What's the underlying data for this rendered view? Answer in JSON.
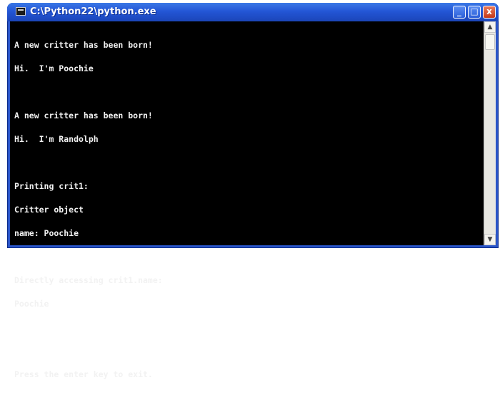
{
  "window": {
    "title": "C:\\Python22\\python.exe",
    "controls": {
      "minimize": "_",
      "maximize": "□",
      "close": "x"
    }
  },
  "console": {
    "lines": [
      "A new critter has been born!",
      "Hi.  I'm Poochie",
      "",
      "A new critter has been born!",
      "Hi.  I'm Randolph",
      "",
      "Printing crit1:",
      "Critter object",
      "name: Poochie",
      "",
      "Directly accessing crit1.name:",
      "Poochie",
      "",
      "",
      "Press the enter key to exit."
    ]
  },
  "scrollbar": {
    "up_arrow": "▲",
    "down_arrow": "▼"
  }
}
